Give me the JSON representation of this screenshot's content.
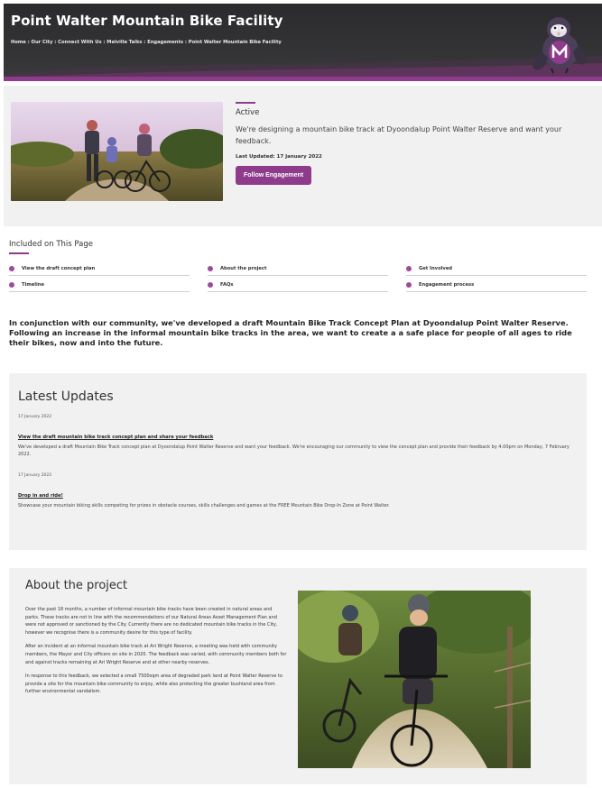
{
  "header": {
    "title": "Point Walter Mountain Bike Facility",
    "breadcrumb": [
      "Home",
      "Our City",
      "Connect With Us",
      "Melville Talks",
      "Engagements",
      "Point Walter Mountain Bike Facility"
    ],
    "separator": ":"
  },
  "hero": {
    "status": "Active",
    "description": "We're designing a mountain bike track at Dyoondalup Point Walter Reserve and want your feedback.",
    "last_updated": "Last Updated: 17 January 2022",
    "follow_label": "Follow Engagement"
  },
  "toc": {
    "title": "Included on This Page",
    "items": [
      "View the draft concept plan",
      "About the project",
      "Get Involved",
      "Timeline",
      "FAQs",
      "Engagement process"
    ]
  },
  "intro": "In conjunction with our community, we've developed a draft Mountain Bike Track Concept Plan at Dyoondalup Point Walter Reserve. Following an increase in the informal mountain bike tracks in the area, we want to create a a safe place for people of all ages to ride their bikes, now and into the future.",
  "updates": {
    "title": "Latest Updates",
    "items": [
      {
        "date": "17 January 2022",
        "link": "View the draft mountain bike track concept plan and share your feedback",
        "text": "We've developed a draft Mountain Bike Track concept plan at Dyoondalup Point Walter Reserve and want your feedback. We're encouraging our community to view the concept plan and provide their feedback by 4.00pm on Monday, 7 February 2022."
      },
      {
        "date": "17 January 2022",
        "link": "Drop in and ride!",
        "text": "Showcase your mountain biking skills competing for prizes in obstacle courses, skills challenges and games at the FREE Mountain Bike Drop-In Zone at Point Walter."
      }
    ]
  },
  "about": {
    "title": "About the project",
    "paragraphs": [
      "Over the past 18 months, a number of informal mountain bike tracks have been created in natural areas and parks. These tracks are not in line with the recommendations of our Natural Areas Asset Management Plan and were not approved or sanctioned by the City. Currently there are no dedicated mountain bike tracks in the City, however we recognise there is a community desire for this type of facility.",
      "After an incident at an informal mountain bike track at Ari Wright Reserve, a meeting was held with community members, the Mayor and City officers on site in 2020. The feedback was varied, with community members both for and against tracks remaining at Ari Wright Reserve and at other nearby reserves.",
      "In response to this feedback, we selected a small 7500sqm area of degraded park land at Point Walter Reserve to provide a site for the mountain bike community to enjoy, while also protecting the greater bushland area from further environmental vandalism."
    ]
  },
  "colors": {
    "brand": "#8e3b8b",
    "header_bg": "#2f2f32",
    "panel_bg": "#f1f1f2"
  }
}
